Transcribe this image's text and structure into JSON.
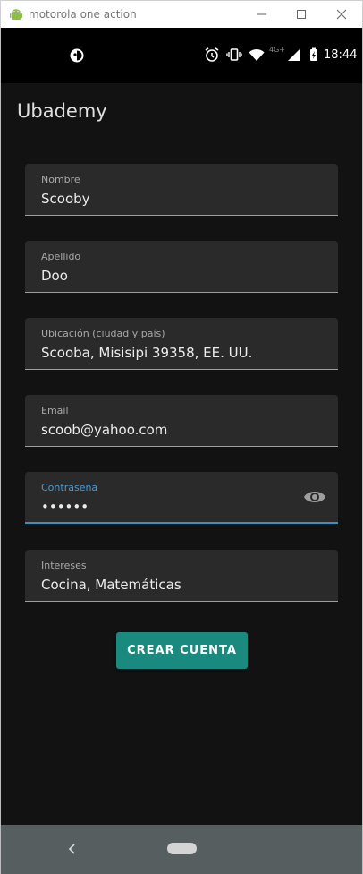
{
  "window": {
    "title": "motorola one action",
    "buttons": [
      "minimize",
      "maximize",
      "close"
    ]
  },
  "status_bar": {
    "time": "18:44",
    "network": "4G+",
    "icons": [
      "app-notification-icon",
      "alarm-icon",
      "vibrate-icon",
      "wifi-icon",
      "signal-icon",
      "battery-icon"
    ]
  },
  "app": {
    "title": "Ubademy"
  },
  "form": {
    "fields": [
      {
        "label": "Nombre",
        "value": "Scooby"
      },
      {
        "label": "Apellido",
        "value": "Doo"
      },
      {
        "label": "Ubicación (ciudad y país)",
        "value": "Scooba, Misisipi 39358, EE. UU."
      },
      {
        "label": "Email",
        "value": "scoob@yahoo.com"
      },
      {
        "label": "Contraseña",
        "value": "••••••",
        "focused": true,
        "toggle_icon": "eye-icon"
      },
      {
        "label": "Intereses",
        "value": "Cocina, Matemáticas"
      }
    ],
    "submit_label": "CREAR CUENTA"
  },
  "colors": {
    "background": "#121212",
    "field_background": "#2a2a2a",
    "accent": "#1b8a7e",
    "focus": "#3c8fc4",
    "nav_bar": "#565e5f"
  },
  "nav_bar": {
    "buttons": [
      "back",
      "home"
    ]
  }
}
